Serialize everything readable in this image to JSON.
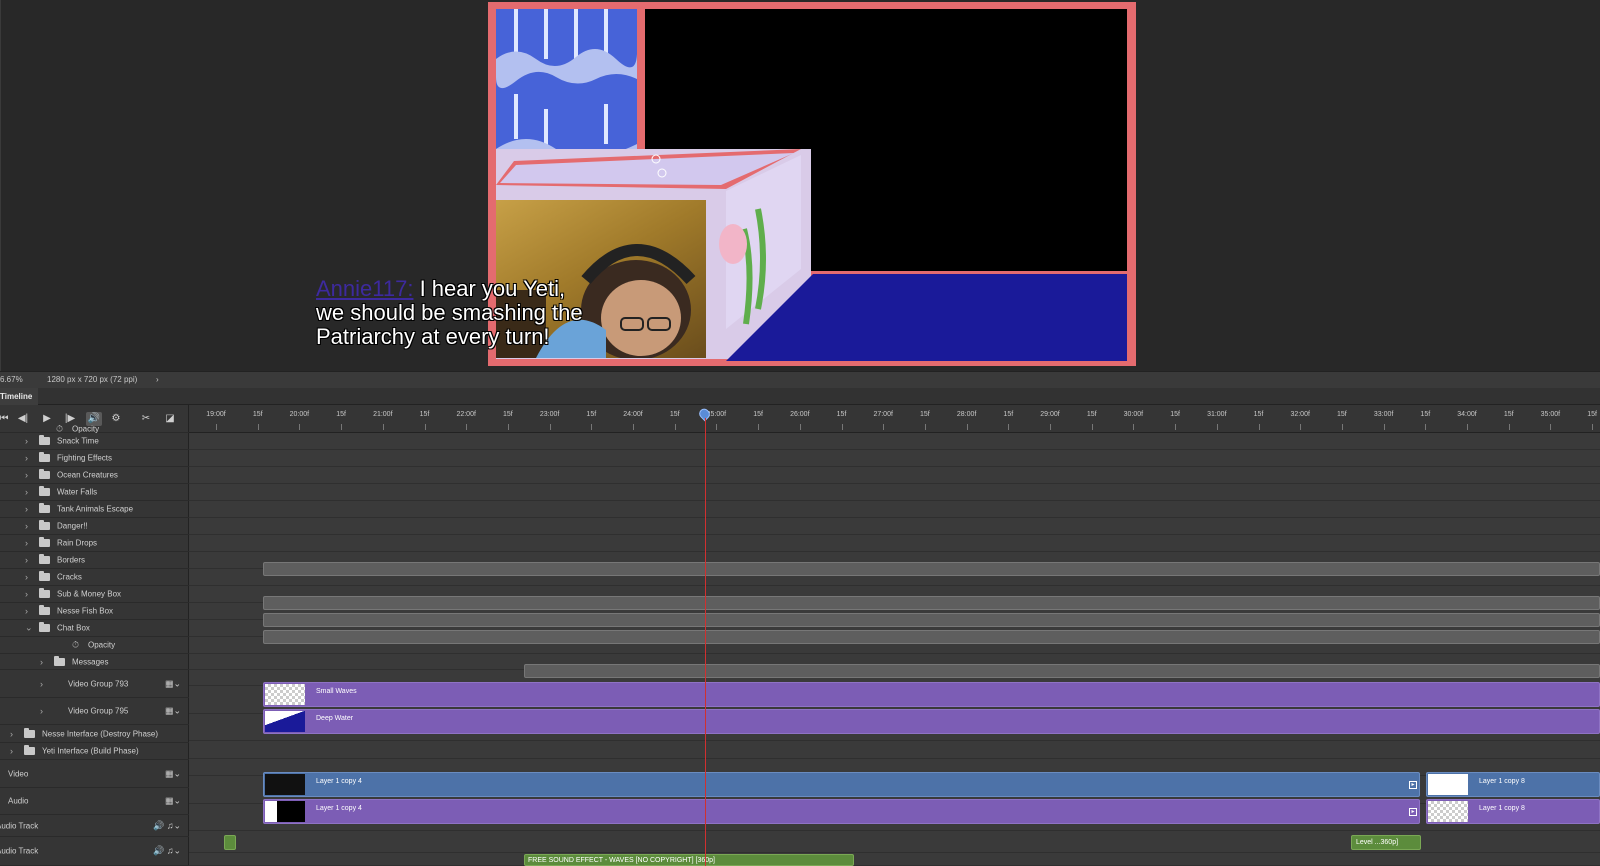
{
  "document": {
    "chat_username": "Annie117:",
    "chat_message_line1": " I hear you Yeti,",
    "chat_message_line2": "we should be smashing the",
    "chat_message_line3": "Patriarchy at every turn!",
    "colors": {
      "border": "#e46b6f",
      "water": "#4763d8",
      "chat_bg": "#1a1a99"
    }
  },
  "statusbar": {
    "zoom": "6.67%",
    "doc_size": "1280 px x 720 px (72 ppi)",
    "arrow": "›"
  },
  "timeline": {
    "tab_label": "Timeline",
    "ruler_labels": [
      "19:00f",
      "15f",
      "20:00f",
      "15f",
      "21:00f",
      "15f",
      "22:00f",
      "15f",
      "23:00f",
      "15f",
      "24:00f",
      "15f",
      "25:00f",
      "15f",
      "26:00f",
      "15f",
      "27:00f",
      "15f",
      "28:00f",
      "15f",
      "29:00f",
      "15f",
      "30:00f",
      "15f",
      "31:00f",
      "15f",
      "32:00f",
      "15f",
      "33:00f",
      "15f",
      "34:00f",
      "15f",
      "35:00f",
      "15f"
    ],
    "controls": {
      "first": "⏮",
      "back": "◀|",
      "play": "▶",
      "fwd": "|▶",
      "audio": "🔊",
      "settings": "⚙",
      "split": "✂",
      "transition": "◪"
    },
    "layers": [
      {
        "label": "Opacity"
      },
      {
        "label": "Snack Time"
      },
      {
        "label": "Fighting Effects"
      },
      {
        "label": "Ocean Creatures"
      },
      {
        "label": "Water Falls"
      },
      {
        "label": "Tank Animals Escape"
      },
      {
        "label": "Danger!!"
      },
      {
        "label": "Rain Drops"
      },
      {
        "label": "Borders"
      },
      {
        "label": "Cracks"
      },
      {
        "label": "Sub & Money Box"
      },
      {
        "label": "Nesse Fish Box"
      },
      {
        "label": "Chat Box"
      },
      {
        "label": "Opacity"
      },
      {
        "label": "Messages"
      },
      {
        "label": "Video Group 793"
      },
      {
        "label": "Video Group 795"
      },
      {
        "label": "Nesse Interface (Destroy Phase)"
      },
      {
        "label": "Yeti Interface (Build Phase)"
      },
      {
        "label": "Video"
      },
      {
        "label": "Audio"
      },
      {
        "label": "Audio Track"
      },
      {
        "label": "Audio Track"
      }
    ],
    "clips": {
      "small_waves": "Small Waves",
      "deep_water": "Deep Water",
      "video_a": "Layer 1 copy 4",
      "video_b": "Layer 1 copy 8",
      "audio_a": "Layer 1 copy 4",
      "audio_b": "Layer 1 copy 8",
      "level": "Level ...360p]",
      "sfx": "FREE SOUND EFFECT - WAVES [NO COPYRIGHT] [360p]"
    }
  }
}
